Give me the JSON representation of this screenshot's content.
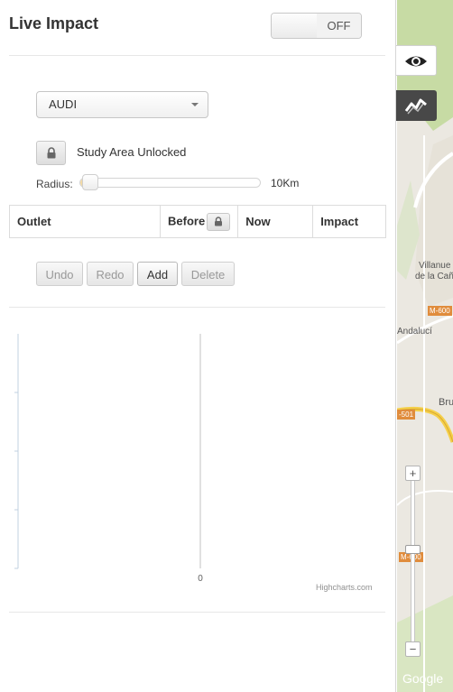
{
  "header": {
    "title": "Live Impact",
    "toggle_state": "OFF"
  },
  "filters": {
    "brand_selected": "AUDI",
    "study_area_status": "Study Area Unlocked",
    "radius_label": "Radius:",
    "radius_value_text": "10Km",
    "radius_fraction": 0.03
  },
  "table": {
    "headers": {
      "outlet": "Outlet",
      "before": "Before",
      "now": "Now",
      "impact": "Impact"
    }
  },
  "actions": {
    "undo": "Undo",
    "redo": "Redo",
    "add": "Add",
    "delete": "Delete"
  },
  "chart_data": {
    "type": "bar",
    "categories": [],
    "series": [],
    "x_ticks": [
      "0"
    ],
    "credits": "Highcharts.com"
  },
  "map": {
    "labels": {
      "town_line1": "Villanue",
      "town_line2": "de la Cañ",
      "road_m600_a": "M-600",
      "road_m501": "-501",
      "road_m600_b": "M-600",
      "area_andaluc": "Andalucí",
      "area_bru": "Bru",
      "google": "Google",
      "zoom_in": "+",
      "zoom_out": "−"
    },
    "colors": {
      "road_yellow": "#f5d04a",
      "green_area": "#c7dba4",
      "land": "#ebe8e1"
    }
  }
}
